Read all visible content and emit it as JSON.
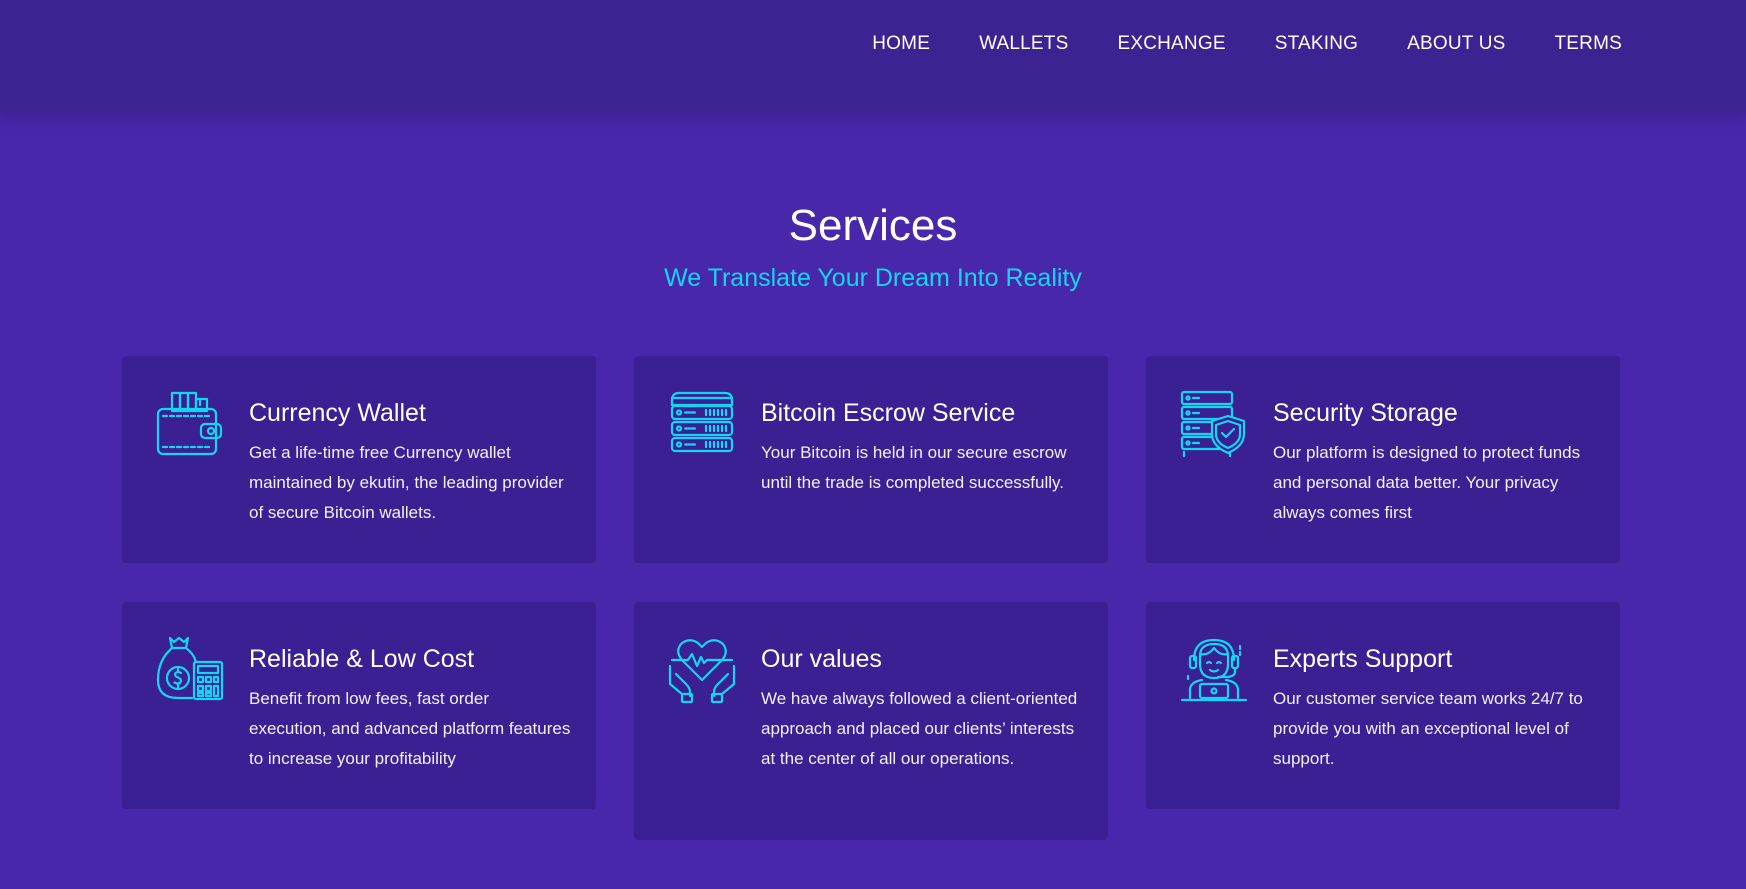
{
  "nav": {
    "items": [
      "HOME",
      "WALLETS",
      "EXCHANGE",
      "STAKING",
      "ABOUT US",
      "TERMS"
    ]
  },
  "services": {
    "title": "Services",
    "subtitle": "We Translate Your Dream Into Reality",
    "cards": [
      {
        "icon": "wallet-icon",
        "title": "Currency Wallet",
        "description": "Get a life-time free Currency wallet maintained by ekutin, the leading provider of secure Bitcoin wallets."
      },
      {
        "icon": "server-icon",
        "title": "Bitcoin Escrow Service",
        "description": "Your Bitcoin is held in our secure escrow until the trade is completed successfully."
      },
      {
        "icon": "server-shield-icon",
        "title": "Security Storage",
        "description": "Our platform is designed to protect funds and personal data better. Your privacy always comes first"
      },
      {
        "icon": "money-bag-calculator-icon",
        "title": "Reliable & Low Cost",
        "description": "Benefit from low fees, fast order execution, and advanced platform features to increase your profitability"
      },
      {
        "icon": "heart-hands-icon",
        "title": "Our values",
        "description": "We have always followed a client-oriented approach and placed our clients’ interests at the center of all our operations."
      },
      {
        "icon": "support-agent-icon",
        "title": "Experts Support",
        "description": "Our customer service team works 24/7 to provide you with an exceptional level of support."
      }
    ]
  },
  "colors": {
    "page_background": "#4927aa",
    "header_background": "#3c2392",
    "card_background": "#3a2092",
    "accent": "#12d7f3",
    "text": "#ffffff"
  }
}
